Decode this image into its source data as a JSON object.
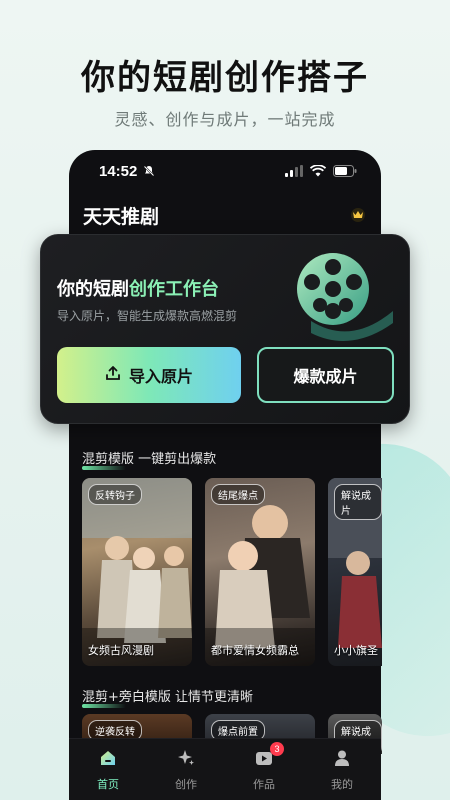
{
  "promo": {
    "title": "你的短剧创作搭子",
    "subtitle": "灵感、创作与成片，一站完成"
  },
  "status_bar": {
    "time": "14:52"
  },
  "app": {
    "title": "天天推剧"
  },
  "workbench": {
    "title_prefix": "你的短剧",
    "title_accent": "创作工作台",
    "subtitle": "导入原片，智能生成爆款高燃混剪",
    "import_label": "导入原片",
    "hot_label": "爆款成片"
  },
  "section1": {
    "title": "混剪模版 一键剪出爆款",
    "cards": [
      {
        "tag": "反转钩子",
        "caption": "女频古风漫剧"
      },
      {
        "tag": "结尾爆点",
        "caption": "都市爱情女频霸总"
      },
      {
        "tag": "解说成片",
        "caption": "小小旗圣"
      }
    ]
  },
  "section2": {
    "title": "混剪+旁白模版 让情节更清晰",
    "cards": [
      {
        "tag": "逆袭反转"
      },
      {
        "tag": "爆点前置"
      },
      {
        "tag": "解说成片"
      }
    ]
  },
  "tabs": [
    {
      "label": "首页",
      "active": true
    },
    {
      "label": "创作"
    },
    {
      "label": "作品",
      "badge": "3"
    },
    {
      "label": "我的"
    }
  ],
  "colors": {
    "accent": "#7ff0c2",
    "button_gradient": [
      "#d3f08b",
      "#7ee8b7",
      "#6fd0ef"
    ],
    "badge": "#ff3b4e"
  }
}
